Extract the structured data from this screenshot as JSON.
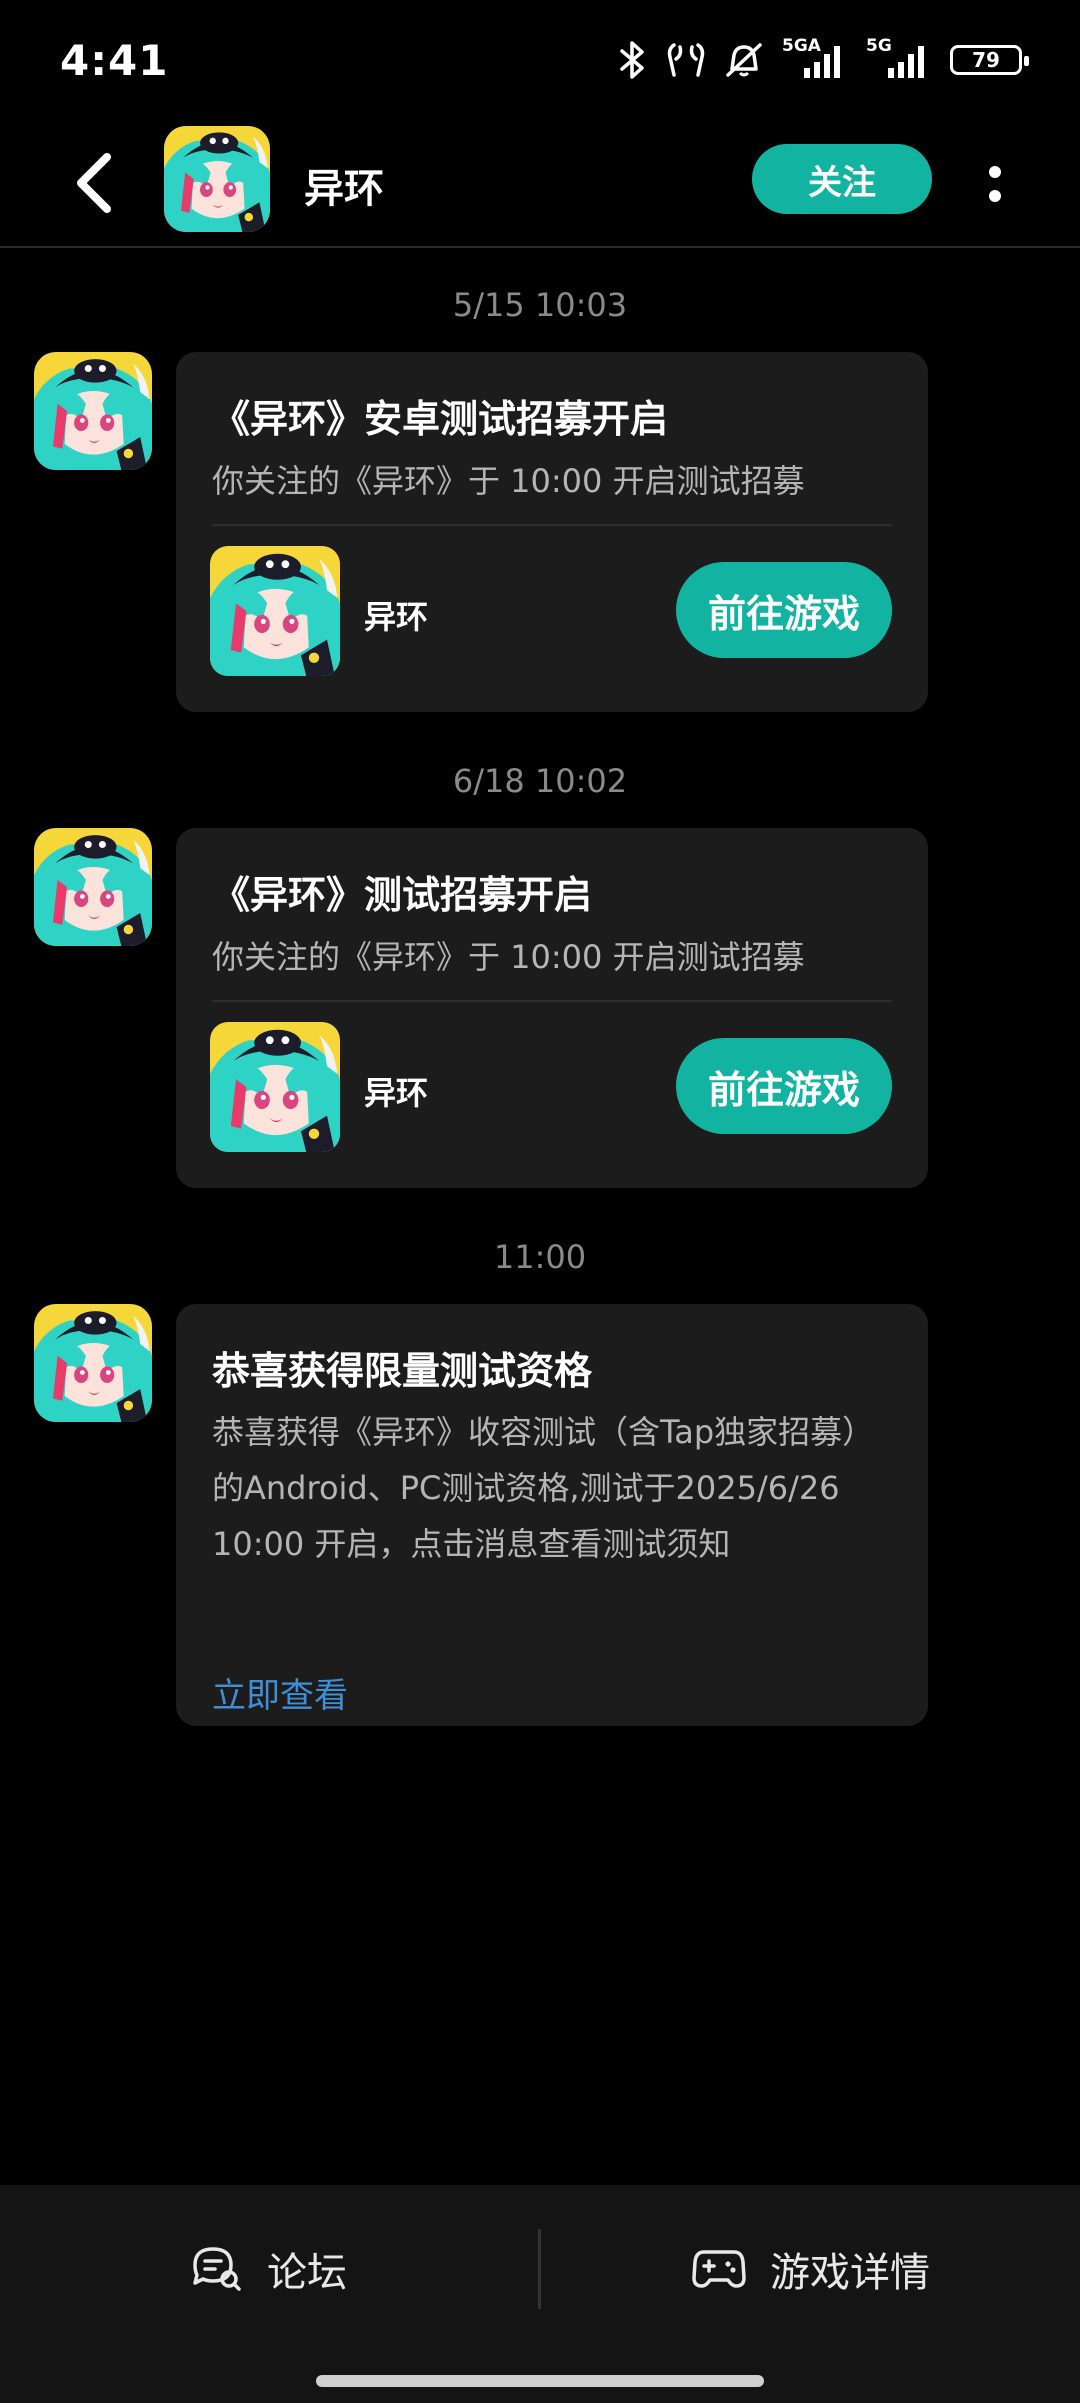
{
  "status_bar": {
    "time": "4:41",
    "net1": "5GA",
    "net2": "5G",
    "battery": "79"
  },
  "header": {
    "title": "异环",
    "follow_label": "关注"
  },
  "messages": [
    {
      "timestamp": "5/15  10:03",
      "title": "《异环》安卓测试招募开启",
      "subtitle": "你关注的《异环》于 10:00 开启测试招募",
      "game_name": "异环",
      "action_label": "前往游戏"
    },
    {
      "timestamp": "6/18  10:02",
      "title": "《异环》测试招募开启",
      "subtitle": "你关注的《异环》于 10:00 开启测试招募",
      "game_name": "异环",
      "action_label": "前往游戏"
    },
    {
      "timestamp": "11:00",
      "title": "恭喜获得限量测试资格",
      "body": "恭喜获得《异环》收容测试（含Tap独家招募）的Android、PC测试资格,测试于2025/6/26 10:00 开启，点击消息查看测试须知",
      "link_label": "立即查看"
    }
  ],
  "bottom_bar": {
    "forum_label": "论坛",
    "details_label": "游戏详情"
  },
  "colors": {
    "accent": "#13b3a1",
    "link": "#3f8fd8",
    "card": "#1c1c1c"
  }
}
